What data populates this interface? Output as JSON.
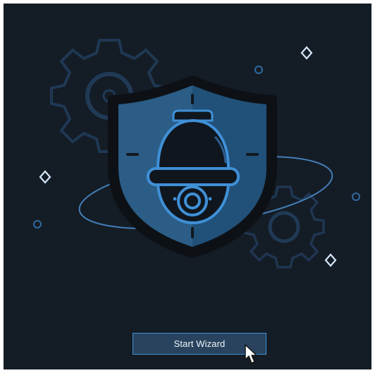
{
  "wizard": {
    "start_button_label": "Start Wizard"
  },
  "illustration": {
    "main_icon": "security-shield-camera-icon",
    "background_icons": [
      "gear-icon",
      "gear-icon",
      "sparkle-icon",
      "circle-icon"
    ]
  },
  "colors": {
    "background": "#141c25",
    "accent": "#3f90d7",
    "shield_fill": "#2b5d86",
    "button_fill": "#29435e",
    "text": "#f1f5f9"
  },
  "pointer": {
    "icon": "mouse-cursor-icon"
  }
}
